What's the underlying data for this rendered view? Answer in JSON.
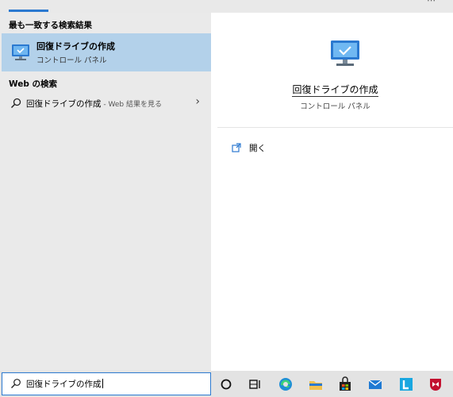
{
  "sections": {
    "best_match": "最も一致する検索結果",
    "web": "Web の検索"
  },
  "best_result": {
    "title": "回復ドライブの作成",
    "subtitle": "コントロール パネル",
    "icon": "monitor-icon"
  },
  "web_result": {
    "title": "回復ドライブの作成",
    "suffix": " - Web 結果を見る",
    "icon": "search-icon"
  },
  "preview": {
    "title": "回復ドライブの作成",
    "subtitle": "コントロール パネル",
    "open_label": "開く"
  },
  "search": {
    "query": "回復ドライブの作成"
  },
  "taskbar": {
    "icons": [
      "cortana-icon",
      "task-view-icon",
      "edge-icon",
      "file-explorer-icon",
      "store-icon",
      "mail-icon",
      "l-app-icon",
      "mcafee-icon"
    ]
  },
  "colors": {
    "accent": "#2b79d0",
    "selection": "#b3d1ea"
  }
}
